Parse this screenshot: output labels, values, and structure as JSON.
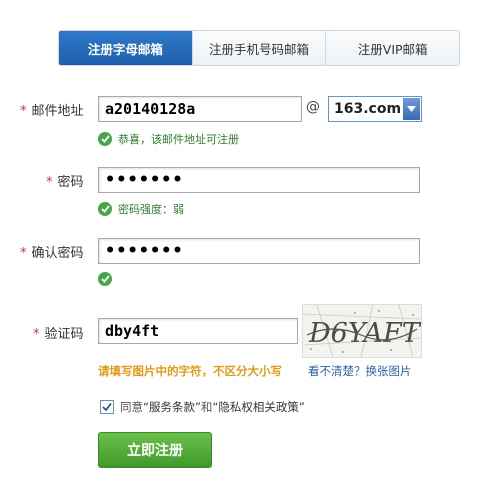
{
  "tabs": [
    {
      "label": "注册字母邮箱",
      "active": true
    },
    {
      "label": "注册手机号码邮箱",
      "active": false
    },
    {
      "label": "注册VIP邮箱",
      "active": false
    }
  ],
  "email": {
    "label": "邮件地址",
    "value": "a20140128a",
    "at": "@",
    "domain": "163.com",
    "hint": "恭喜，该邮件地址可注册"
  },
  "password": {
    "label": "密码",
    "value": "•••••••",
    "strength_hint": "密码强度：弱"
  },
  "confirm": {
    "label": "确认密码",
    "value": "•••••••"
  },
  "captcha": {
    "label": "验证码",
    "value": "dby4ft",
    "image_text": "D6YAFT",
    "warning": "请填写图片中的字符，不区分大小写",
    "refresh": "看不清楚？换张图片"
  },
  "agree": {
    "prefix": "同意",
    "terms": "“服务条款”",
    "and": "和",
    "privacy": "“隐私权相关政策”",
    "checked": true
  },
  "submit_label": "立即注册",
  "colors": {
    "tab_active": "#2668b7",
    "required_star": "#d23232",
    "success": "#49a54a",
    "warning": "#e19a1b",
    "link": "#2d5fa8",
    "submit": "#4ea634"
  }
}
